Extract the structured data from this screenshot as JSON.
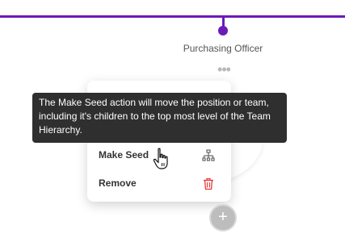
{
  "node": {
    "label": "Purchasing Officer",
    "more_icon": "more-horizontal-icon"
  },
  "menu": {
    "items": [
      {
        "label": "Make Seed",
        "icon": "hierarchy-icon"
      },
      {
        "label": "Remove",
        "icon": "trash-icon"
      }
    ]
  },
  "tooltip": {
    "text": "The Make Seed action will move the position or team, including it's children to the top most level of the Team Hierarchy."
  },
  "add_button": {
    "glyph": "+",
    "icon": "plus-icon"
  },
  "colors": {
    "connector": "#6a1bb8",
    "remove_icon": "#e53935",
    "tooltip_bg": "#2f2f2f",
    "add_button_bg": "#bdbdbd"
  }
}
